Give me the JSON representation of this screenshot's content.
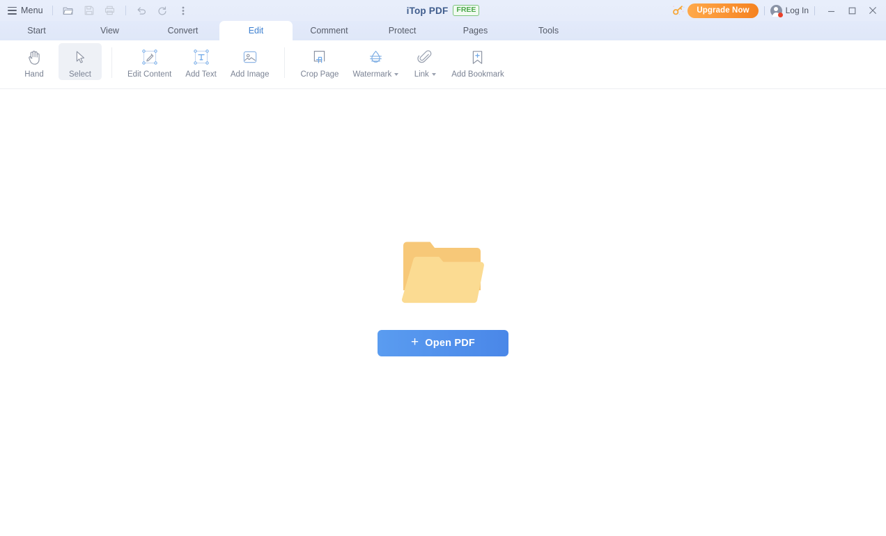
{
  "titlebar": {
    "menu_label": "Menu",
    "menu_icon": "hamburger-icon",
    "quick_tools": [
      {
        "name": "open-file-icon",
        "tooltip": "Open"
      },
      {
        "name": "save-icon",
        "tooltip": "Save"
      },
      {
        "name": "print-icon",
        "tooltip": "Print"
      },
      {
        "name": "undo-icon",
        "tooltip": "Undo"
      },
      {
        "name": "redo-icon",
        "tooltip": "Redo"
      },
      {
        "name": "more-options-icon",
        "tooltip": "More"
      }
    ],
    "app_name": "iTop PDF",
    "edition_badge": "FREE",
    "key_icon": "key-sparkle-icon",
    "upgrade_label": "Upgrade Now",
    "login_label": "Log In",
    "avatar_icon": "user-avatar-icon",
    "notification_dot": true,
    "window_controls": {
      "minimize": "minimize-icon",
      "maximize": "maximize-icon",
      "close": "close-icon"
    }
  },
  "tabs": {
    "active": "Edit",
    "items": [
      {
        "label": "Start"
      },
      {
        "label": "View"
      },
      {
        "label": "Convert"
      },
      {
        "label": "Edit"
      },
      {
        "label": "Comment"
      },
      {
        "label": "Protect"
      },
      {
        "label": "Pages"
      },
      {
        "label": "Tools"
      }
    ]
  },
  "ribbon": {
    "groups": [
      {
        "items": [
          {
            "label": "Hand",
            "icon": "hand-icon",
            "active": false,
            "caret": false
          },
          {
            "label": "Select",
            "icon": "cursor-arrow-icon",
            "active": true,
            "caret": false
          }
        ]
      },
      {
        "items": [
          {
            "label": "Edit Content",
            "icon": "edit-content-icon",
            "active": false,
            "caret": false
          },
          {
            "label": "Add Text",
            "icon": "add-text-icon",
            "active": false,
            "caret": false
          },
          {
            "label": "Add Image",
            "icon": "add-image-icon",
            "active": false,
            "caret": false
          }
        ]
      },
      {
        "items": [
          {
            "label": "Crop Page",
            "icon": "crop-page-icon",
            "active": false,
            "caret": false
          },
          {
            "label": "Watermark",
            "icon": "watermark-icon",
            "active": false,
            "caret": true
          },
          {
            "label": "Link",
            "icon": "link-paperclip-icon",
            "active": false,
            "caret": true
          },
          {
            "label": "Add Bookmark",
            "icon": "add-bookmark-icon",
            "active": false,
            "caret": false
          }
        ]
      }
    ]
  },
  "content": {
    "illustration": "open-folder-illustration",
    "open_button_label": "Open PDF",
    "open_button_icon": "plus-icon"
  },
  "colors": {
    "titlebar_bg": "#e7edfa",
    "tabbar_bg": "#e1e9f8",
    "accent_blue": "#3c7fd0",
    "upgrade_orange": "#f58220",
    "badge_green": "#4aa84a",
    "button_blue": "#4f92ec",
    "folder_back": "#f7c878",
    "folder_front": "#fbdb92",
    "notification_red": "#e8402a"
  }
}
